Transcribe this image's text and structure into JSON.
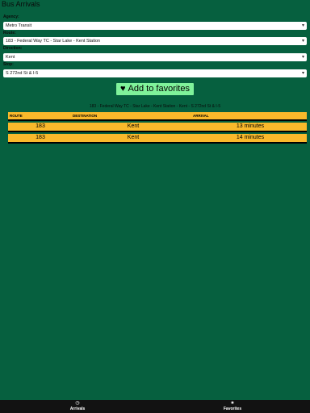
{
  "app": {
    "title": "Bus Arrivals"
  },
  "form": {
    "agency": {
      "label": "Agency:",
      "value": "Metro Transit"
    },
    "route": {
      "label": "Route:",
      "value": "183 - Federal Way TC - Star Lake - Kent Station"
    },
    "direction": {
      "label": "Direction:",
      "value": "Kent"
    },
    "stop": {
      "label": "Stop:",
      "value": "S 272nd St & I-5"
    }
  },
  "favorites_button": {
    "label": "Add to favorites",
    "icon": "heart-icon"
  },
  "results": {
    "subtitle": "183 - Federal Way TC - Star Lake - Kent Station - Kent - S 272nd St & I-5",
    "columns": [
      "ROUTE",
      "DESTINATION",
      "ARRIVAL"
    ],
    "rows": [
      {
        "route": "183",
        "destination": "Kent",
        "arrival": "13 minutes"
      },
      {
        "route": "183",
        "destination": "Kent",
        "arrival": "14 minutes"
      }
    ]
  },
  "nav": {
    "arrivals": {
      "label": "Arrivals",
      "icon": "clock-icon"
    },
    "favorites": {
      "label": "Favorites",
      "icon": "star-icon"
    }
  },
  "colors": {
    "background": "#06603f",
    "table": "#f9b92b",
    "button": "#7ff29a",
    "nav": "#121212"
  }
}
